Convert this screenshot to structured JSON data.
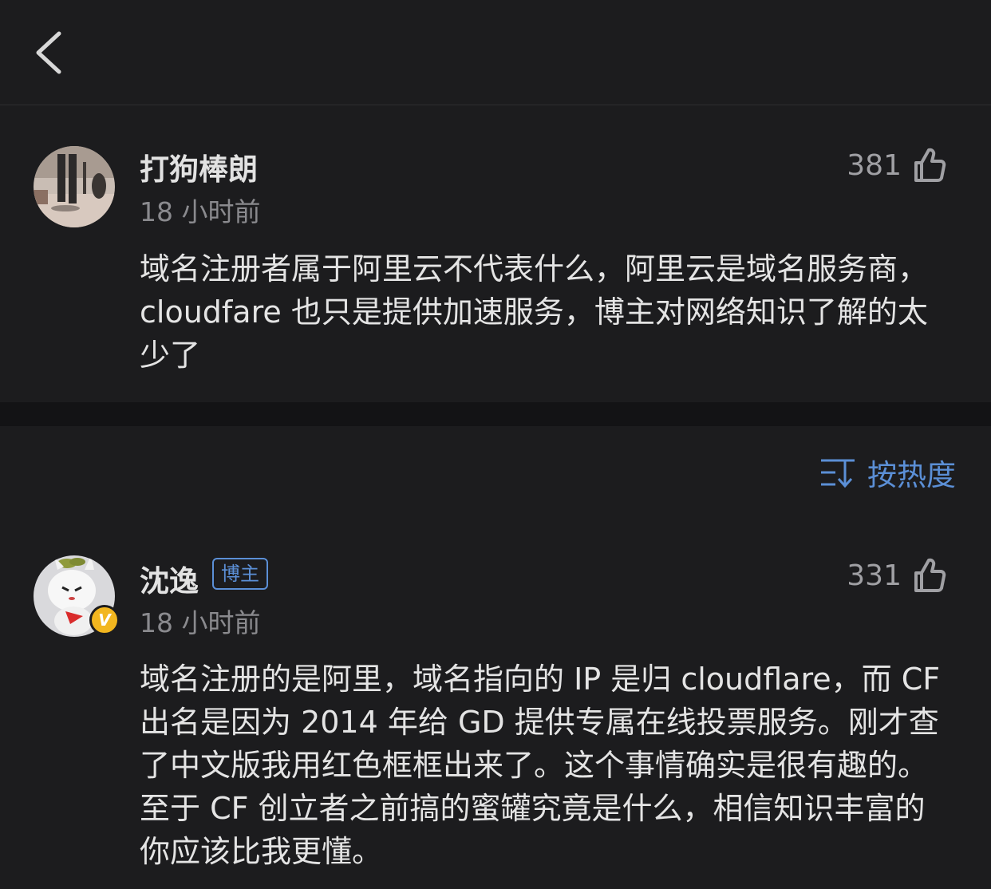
{
  "nav": {
    "back_icon": "chevron-left-icon"
  },
  "comments": [
    {
      "username": "打狗棒朗",
      "timestamp": "18 小时前",
      "likes": "381",
      "text": "域名注册者属于阿里云不代表什么，阿里云是域名服务商，cloudfare 也只是提供加速服务，博主对网络知识了解的太少了"
    },
    {
      "username": "沈逸",
      "author_tag": "博主",
      "verified_badge": "V",
      "timestamp": "18 小时前",
      "likes": "331",
      "text": "域名注册的是阿里，域名指向的 IP 是归 cloudflare，而 CF 出名是因为 2014 年给 GD 提供专属在线投票服务。刚才查了中文版我用红色框框出来了。这个事情确实是很有趣的。至于 CF 创立者之前搞的蜜罐究竟是什么，相信知识丰富的你应该比我更懂。"
    }
  ],
  "sort": {
    "label": "按热度",
    "icon": "sort-icon"
  },
  "colors": {
    "background": "#1c1c1e",
    "separator": "#131315",
    "accent": "#5b8fd6",
    "muted_text": "#8a8a8e",
    "badge": "#f2b61f"
  }
}
